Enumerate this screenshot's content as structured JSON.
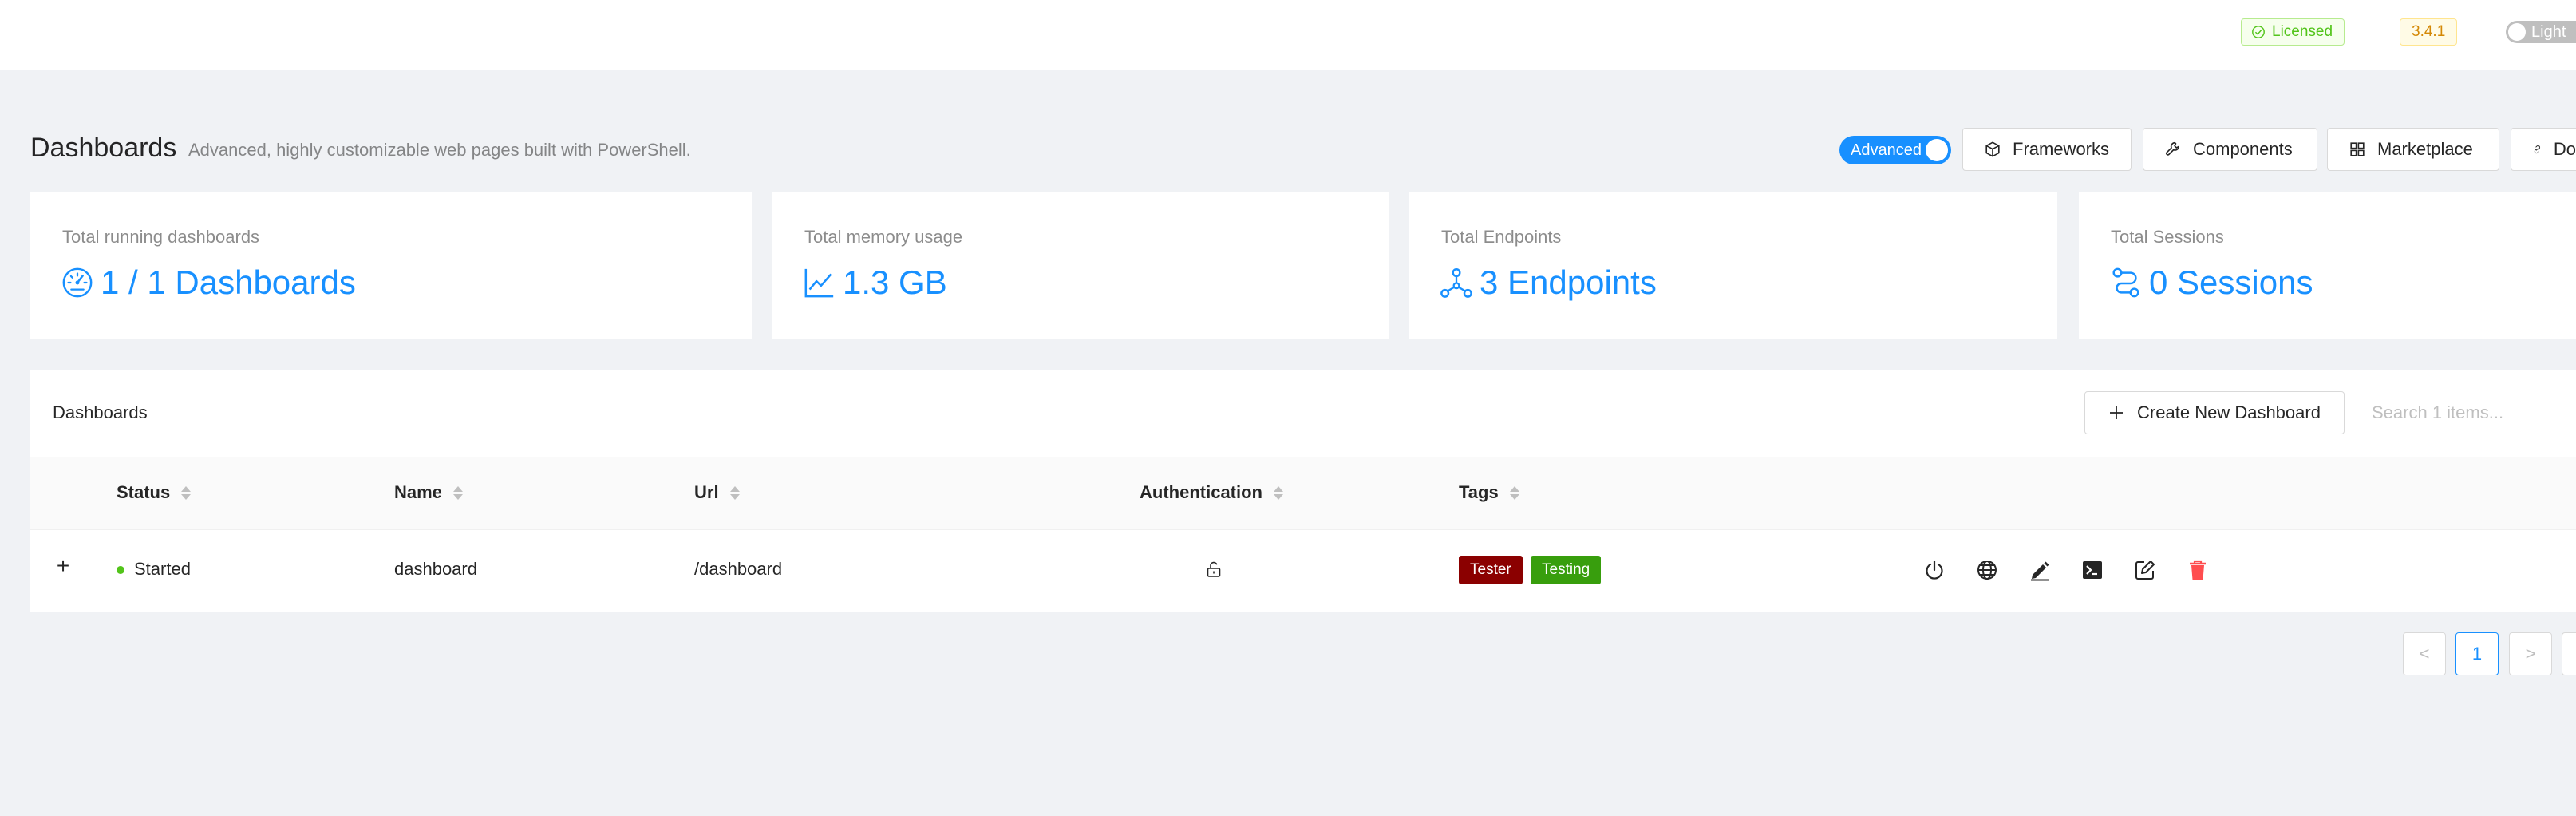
{
  "header": {
    "licensed_label": "Licensed",
    "version": "3.4.1",
    "theme_label": "Light"
  },
  "page": {
    "title": "Dashboards",
    "subtitle": "Advanced, highly customizable web pages built with PowerShell.",
    "advanced_label": "Advanced",
    "buttons": {
      "frameworks": "Frameworks",
      "components": "Components",
      "marketplace": "Marketplace",
      "docs": "Do"
    }
  },
  "stats": {
    "dashboards": {
      "title": "Total running dashboards",
      "value": "1 / 1 Dashboards",
      "icon": "dashboard-gauge-icon"
    },
    "memory": {
      "title": "Total memory usage",
      "value": "1.3 GB",
      "icon": "line-chart-icon"
    },
    "endpoints": {
      "title": "Total Endpoints",
      "value": "3 Endpoints",
      "icon": "deployment-unit-icon"
    },
    "sessions": {
      "title": "Total Sessions",
      "value": "0 Sessions",
      "icon": "sessions-icon"
    }
  },
  "table": {
    "title": "Dashboards",
    "create_label": "Create New Dashboard",
    "search_placeholder": "Search 1 items...",
    "columns": {
      "status": "Status",
      "name": "Name",
      "url": "Url",
      "authentication": "Authentication",
      "tags": "Tags"
    },
    "rows": [
      {
        "expand": "+",
        "status": "Started",
        "name": "dashboard",
        "url": "/dashboard",
        "authentication_icon": "unlock-icon",
        "tags": [
          "Tester",
          "Testing"
        ]
      }
    ]
  },
  "pagination": {
    "prev": "<",
    "current": "1",
    "next": ">"
  },
  "colors": {
    "primary": "#1890ff",
    "success": "#52c41a",
    "tag_tester": "#8b0000",
    "tag_testing": "#389e0d",
    "danger": "#ff4d4f"
  }
}
